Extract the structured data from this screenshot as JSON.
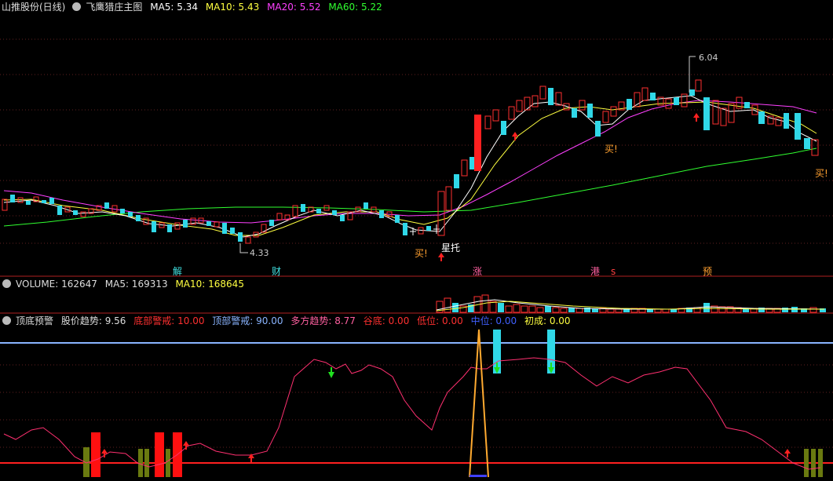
{
  "colors": {
    "up": "#ff3030",
    "down": "#30d8e8",
    "ma5": "#ffffff",
    "ma10": "#ffff40",
    "ma20": "#ff40ff",
    "ma60": "#30ff30",
    "panel_border": "#b02020"
  },
  "header": {
    "app_title": "山推股份(日线)",
    "indicator_title": "飞鹰猎庄主图",
    "ma5": "MA5: 5.34",
    "ma10": "MA10: 5.43",
    "ma20": "MA20: 5.52",
    "ma60": "MA60: 5.22"
  },
  "price_labels": {
    "high": "6.04",
    "low": "4.33"
  },
  "signals": {
    "buy": "买!",
    "star": "星托"
  },
  "events": [
    "解",
    "财",
    "涨",
    "港",
    "s",
    "预"
  ],
  "volume": {
    "title": "VOLUME: 162647",
    "ma5": "MA5: 169313",
    "ma10": "MA10: 168645"
  },
  "osc": {
    "title": "顶底预警",
    "trend": "股价趋势: 9.56",
    "bottom_warn": "底部警戒: 10.00",
    "top_warn": "顶部警戒: 90.00",
    "bull_trend": "多方趋势: 8.77",
    "valley": "谷底: 0.00",
    "low": "低位: 0.00",
    "mid": "中位: 0.00",
    "initial": "初成: 0.00"
  }
}
